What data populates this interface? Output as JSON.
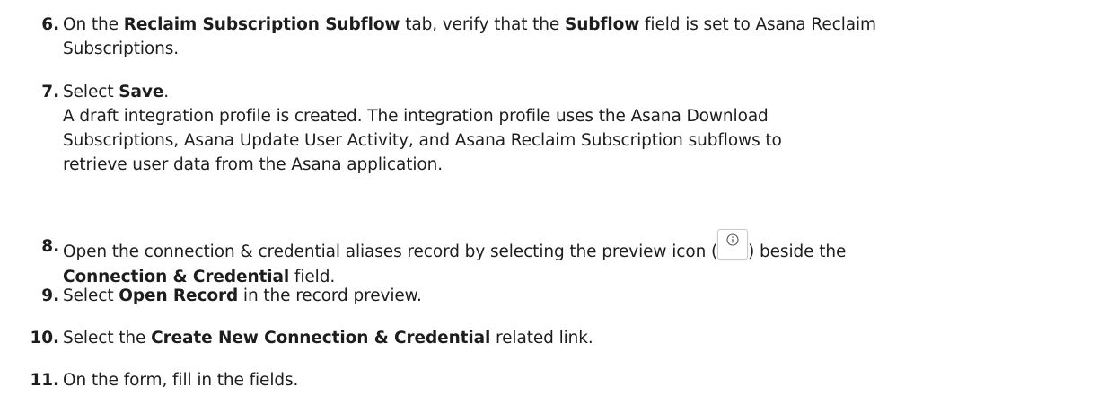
{
  "steps": [
    {
      "number": "6.",
      "parts": [
        "On the ",
        "Reclaim Subscription Subflow",
        " tab, verify that the ",
        "Subflow",
        " field is set to Asana Reclaim",
        "Subscriptions."
      ]
    },
    {
      "number": "7.",
      "parts": [
        "Select ",
        "Save",
        "."
      ],
      "note_lines": [
        "A draft integration profile is created. The integration profile uses the Asana Download",
        "Subscriptions, Asana Update User Activity, and Asana Reclaim Subscription subflows to",
        "retrieve user data from the Asana application."
      ]
    },
    {
      "number": "8.",
      "parts": [
        "Open the connection & credential aliases record by selecting the preview icon (",
        ") beside the",
        "Connection & Credential",
        " field."
      ],
      "icon": "info-circle-icon"
    },
    {
      "number": "9.",
      "parts": [
        "Select ",
        "Open Record",
        " in the record preview."
      ]
    },
    {
      "number": "10.",
      "parts": [
        "Select the ",
        "Create New Connection & Credential",
        " related link."
      ]
    },
    {
      "number": "11.",
      "parts": [
        "On the form, fill in the fields."
      ]
    }
  ],
  "colors": {
    "text": "#1d1d1d",
    "icon_border": "#c9c9c9"
  }
}
